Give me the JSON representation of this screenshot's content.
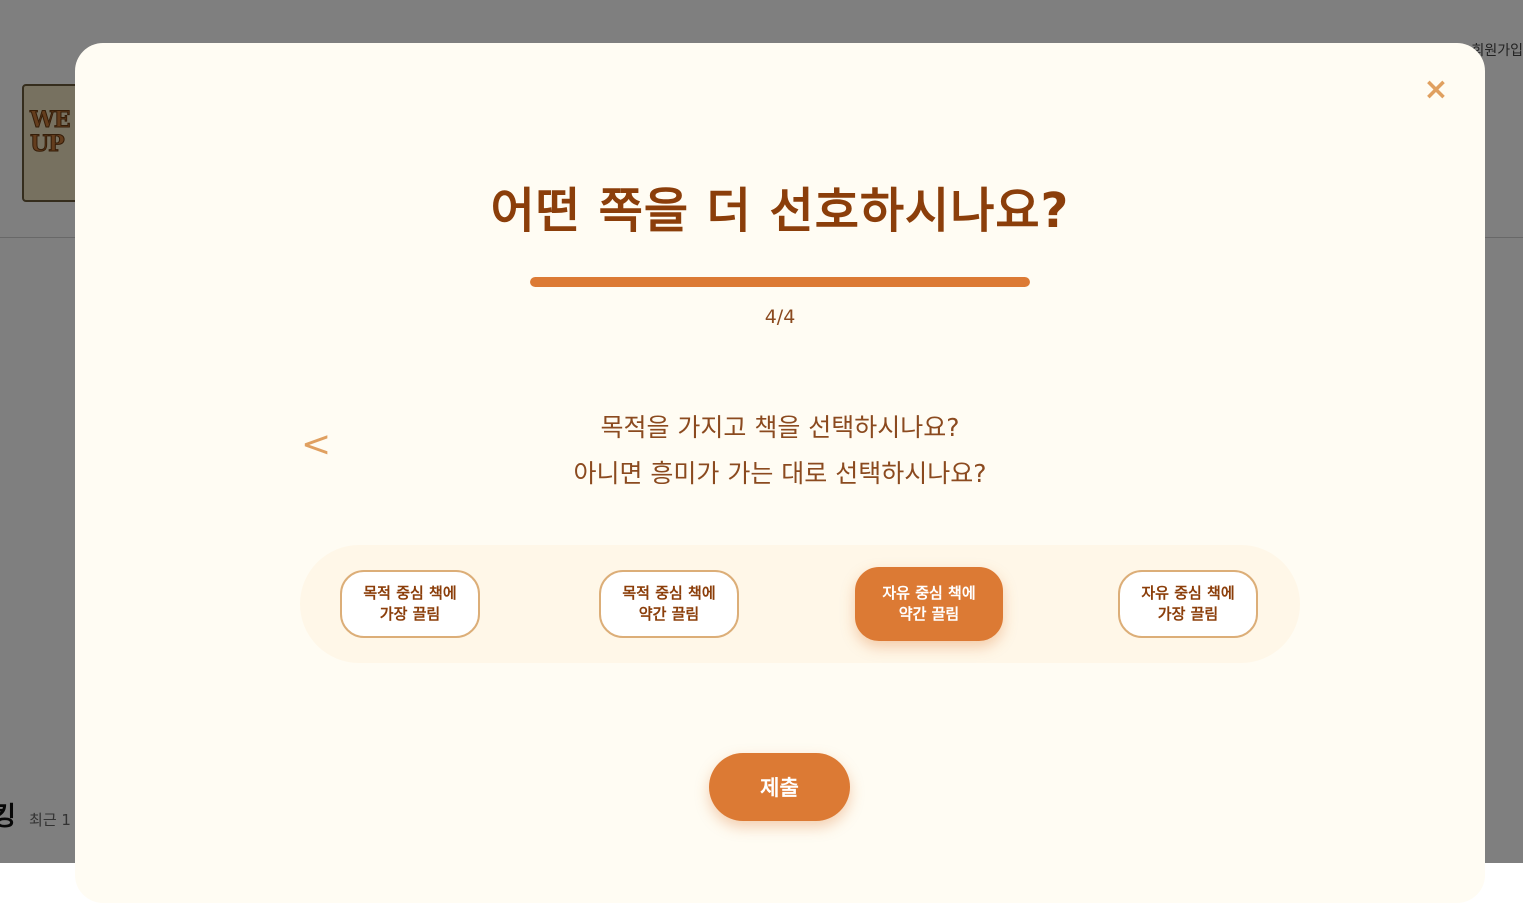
{
  "background": {
    "logo_text": "WE READ UP",
    "signup_label": "회원가입",
    "ranking_title": "킹",
    "ranking_subtitle": "최근 1"
  },
  "modal": {
    "title": "어떤 쪽을 더 선호하시나요?",
    "progress": {
      "current": 4,
      "total": 4,
      "label": "4/4"
    },
    "prev_label": "<",
    "close_label": "×",
    "question_line1": "목적을 가지고 책을 선택하시나요?",
    "question_line2": "아니면 흥미가 가는 대로 선택하시나요?",
    "options": [
      {
        "line1": "목적 중심 책에",
        "line2": "가장 끌림",
        "selected": false
      },
      {
        "line1": "목적 중심 책에",
        "line2": "약간 끌림",
        "selected": false
      },
      {
        "line1": "자유 중심 책에",
        "line2": "약간 끌림",
        "selected": true
      },
      {
        "line1": "자유 중심 책에",
        "line2": "가장 끌림",
        "selected": false
      }
    ],
    "submit_label": "제출"
  },
  "colors": {
    "accent": "#dc7a34",
    "title": "#8b3e0a",
    "modal_bg": "#fffcf3",
    "option_border": "#dcae78"
  }
}
